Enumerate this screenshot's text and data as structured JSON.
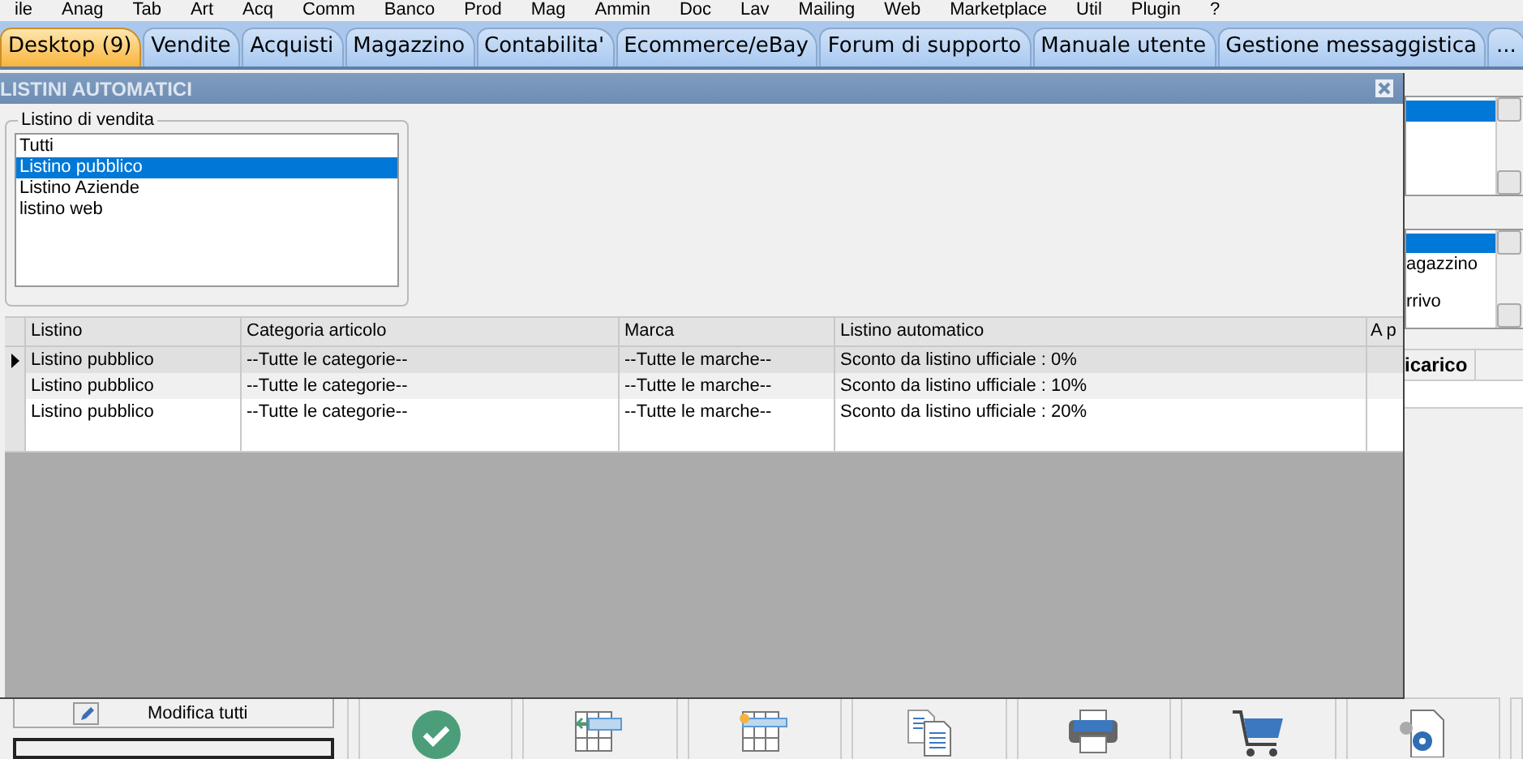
{
  "menu": [
    "ile",
    "Anag",
    "Tab",
    "Art",
    "Acq",
    "Comm",
    "Banco",
    "Prod",
    "Mag",
    "Ammin",
    "Doc",
    "Lav",
    "Mailing",
    "Web",
    "Marketplace",
    "Util",
    "Plugin",
    "?"
  ],
  "tabs": [
    {
      "label": "Desktop (9)",
      "selected": true
    },
    {
      "label": "Vendite",
      "selected": false
    },
    {
      "label": "Acquisti",
      "selected": false
    },
    {
      "label": "Magazzino",
      "selected": false
    },
    {
      "label": "Contabilita'",
      "selected": false
    },
    {
      "label": "Ecommerce/eBay",
      "selected": false
    },
    {
      "label": "Forum di supporto",
      "selected": false
    },
    {
      "label": "Manuale utente",
      "selected": false
    },
    {
      "label": "Gestione messaggistica",
      "selected": false
    },
    {
      "label": "...",
      "selected": false
    }
  ],
  "background": {
    "lower_list": [
      "agazzino",
      "rrivo"
    ],
    "grid_header": "icarico",
    "edit_all_button": "Modifica tutti"
  },
  "dialog": {
    "title": "LISTINI AUTOMATICI",
    "price_list_group": {
      "label": "Listino di vendita",
      "items": [
        {
          "label": "Tutti",
          "selected": false
        },
        {
          "label": "Listino pubblico",
          "selected": true
        },
        {
          "label": "Listino Aziende",
          "selected": false
        },
        {
          "label": "listino web",
          "selected": false
        }
      ]
    },
    "grid": {
      "columns": [
        "Listino",
        "Categoria articolo",
        "Marca",
        "Listino automatico",
        "A p"
      ],
      "rows": [
        {
          "current": true,
          "cells": [
            "Listino pubblico",
            "--Tutte le categorie--",
            "--Tutte le marche--",
            "Sconto da listino ufficiale : 0%"
          ]
        },
        {
          "current": false,
          "cells": [
            "Listino pubblico",
            "--Tutte le categorie--",
            "--Tutte le marche--",
            "Sconto da listino ufficiale : 10%"
          ]
        },
        {
          "current": false,
          "cells": [
            "Listino pubblico",
            "--Tutte le categorie--",
            "--Tutte le marche--",
            "Sconto da listino ufficiale : 20%"
          ]
        }
      ]
    }
  }
}
